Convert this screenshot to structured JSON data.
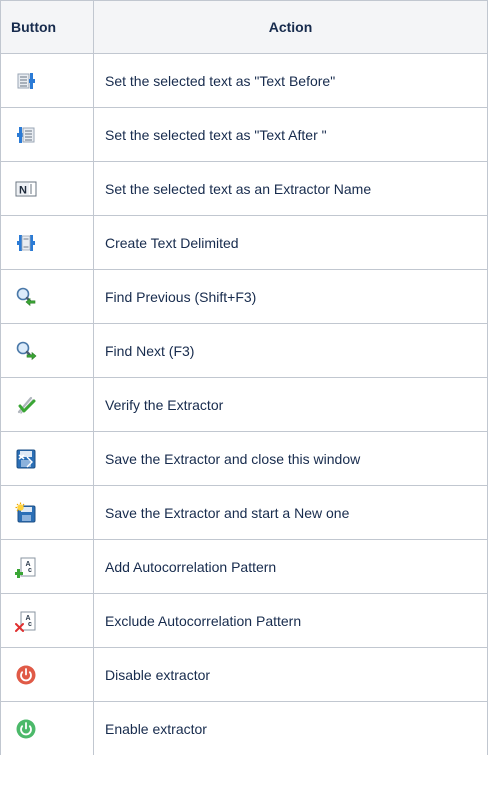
{
  "table": {
    "headers": {
      "button": "Button",
      "action": "Action"
    },
    "rows": [
      {
        "icon": "text-before-icon",
        "action": "Set the selected text as \"Text Before\""
      },
      {
        "icon": "text-after-icon",
        "action": "Set the selected text as \"Text After \""
      },
      {
        "icon": "extractor-name-icon",
        "action": "Set the selected text as an Extractor Name"
      },
      {
        "icon": "text-delimited-icon",
        "action": "Create Text Delimited"
      },
      {
        "icon": "find-previous-icon",
        "action": "Find Previous (Shift+F3)"
      },
      {
        "icon": "find-next-icon",
        "action": "Find Next (F3)"
      },
      {
        "icon": "verify-icon",
        "action": "Verify the Extractor"
      },
      {
        "icon": "save-close-icon",
        "action": "Save the Extractor and close this window"
      },
      {
        "icon": "save-new-icon",
        "action": "Save the Extractor and start a New one"
      },
      {
        "icon": "add-autocorrelation-icon",
        "action": "Add Autocorrelation Pattern"
      },
      {
        "icon": "exclude-autocorrelation-icon",
        "action": "Exclude Autocorrelation Pattern"
      },
      {
        "icon": "disable-power-icon",
        "action": "Disable extractor"
      },
      {
        "icon": "enable-power-icon",
        "action": "Enable extractor"
      }
    ],
    "icon_glyph": "N"
  },
  "colors": {
    "header_bg": "#f4f5f7",
    "border": "#c1c7d0",
    "text": "#172b4d",
    "accent_blue": "#2b7bd6",
    "accent_green": "#3aa635",
    "accent_red": "#e05a47"
  }
}
